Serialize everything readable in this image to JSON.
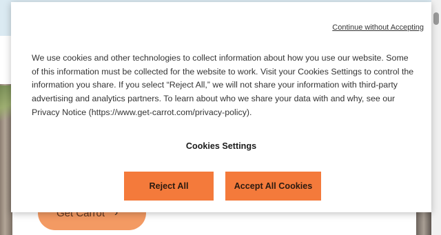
{
  "background": {
    "cta_label": "Get Carrot",
    "cta_arrow": "›"
  },
  "banner": {
    "continue_link": "Continue without Accepting",
    "notice_text": "We use cookies and other technologies to collect information about how you use our website. Some of this information must be collected for the website to work. Visit your Cookies Settings to control the information you share. If you select “Reject All,” we will not share your information with third-party advertising and analytics partners. To learn about who we share your data with and why, see our Privacy Notice (https://www.get-carrot.com/privacy-policy).",
    "settings_link": "Cookies Settings",
    "reject_label": "Reject All",
    "accept_label": "Accept All Cookies"
  },
  "colors": {
    "accent": "#f47a3b",
    "cta_background": "#f39a63",
    "topbar": "#dbeaf2"
  }
}
